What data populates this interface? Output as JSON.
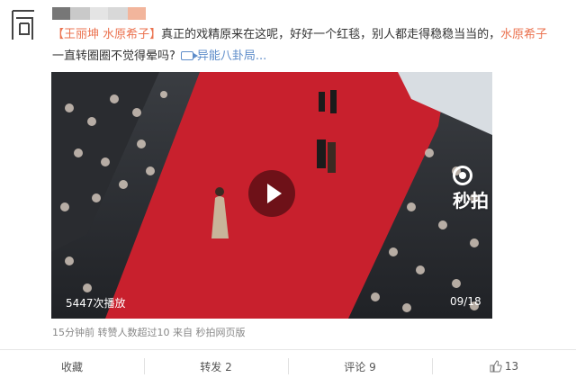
{
  "post": {
    "segments": [
      {
        "text": "【王丽坤 水原希子】",
        "style": "link"
      },
      {
        "text": "真正的戏精原来在这呢，好好一个红毯，别人都走得稳稳当当的，",
        "style": "plain"
      },
      {
        "text": "水原希子",
        "style": "link"
      }
    ],
    "line2": "一直转圈圈不觉得晕吗?",
    "video_link_label": "异能八卦局..."
  },
  "video": {
    "watermark": "秒拍",
    "play_count": "5447次播放",
    "duration": "09/18"
  },
  "meta": "15分钟前  转赞人数超过10  来自 秒拍网页版",
  "actions": {
    "collect": "收藏",
    "repost": "转发 2",
    "comment": "评论 9",
    "like": "13"
  },
  "colors": {
    "link": "#eb7350",
    "blue_link": "#5d8cc9",
    "carpet": "#c8202d"
  }
}
